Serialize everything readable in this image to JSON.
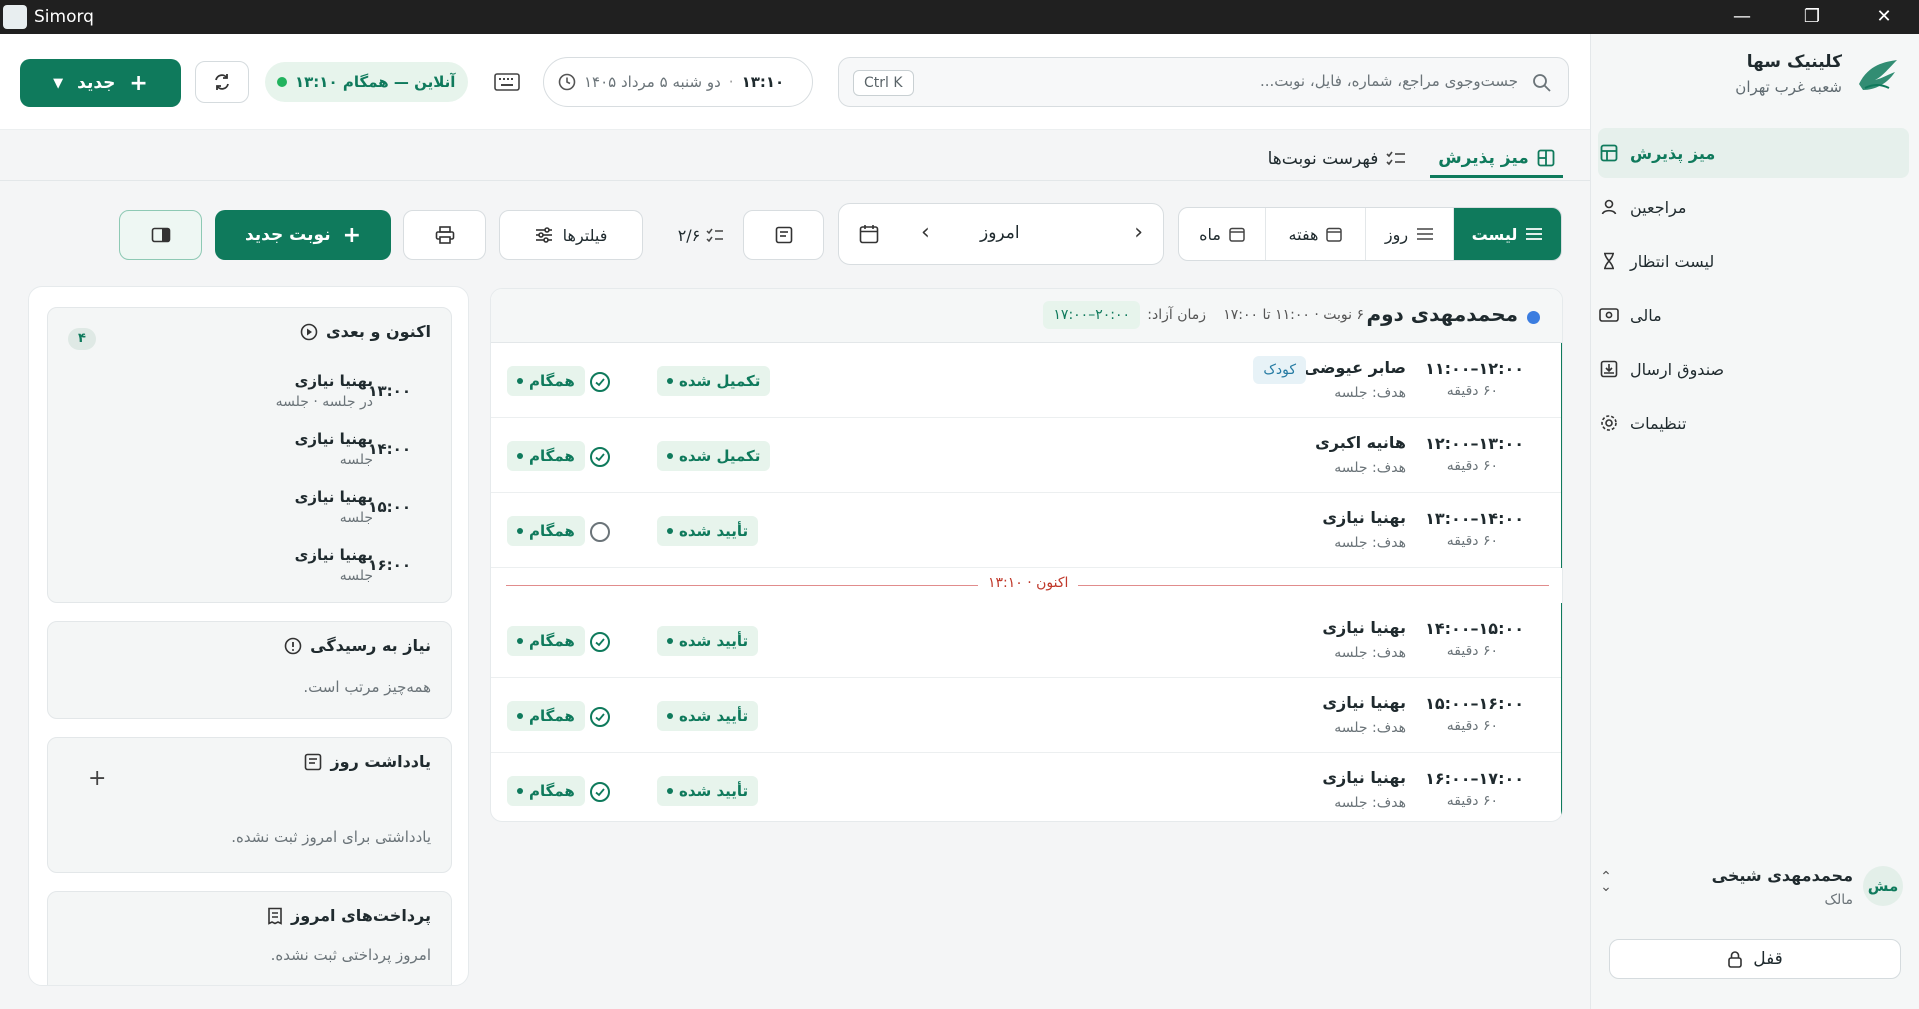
{
  "window": {
    "title": "Simorq"
  },
  "brand": {
    "name": "کلینیک سها",
    "branch": "شعبه غرب تهران"
  },
  "sidebar": {
    "items": [
      {
        "label": "میز پذیرش",
        "active": true,
        "icon": "layout-icon"
      },
      {
        "label": "مراجعین",
        "active": false,
        "icon": "user-icon"
      },
      {
        "label": "لیست انتظار",
        "active": false,
        "icon": "hourglass-icon"
      },
      {
        "label": "مالی",
        "active": false,
        "icon": "money-icon"
      },
      {
        "label": "صندوق ارسال",
        "active": false,
        "icon": "outbox-icon"
      },
      {
        "label": "تنظیمات",
        "active": false,
        "icon": "gear-icon"
      }
    ],
    "user": {
      "initials": "مش",
      "name": "محمدمهدی شیخی",
      "role": "مالک"
    },
    "lock_label": "قفل"
  },
  "header": {
    "search_placeholder": "جست‌وجوی مراجع، شماره، فایل، نوبت...",
    "shortcut": "Ctrl K",
    "date": "دو شنبه ۵ مرداد ۱۴۰۵",
    "time": "۱۳:۱۰",
    "status": "آنلاین — همگام ۱۳:۱۰",
    "new_label": "جدید"
  },
  "tabs": [
    {
      "label": "میز پذیرش",
      "active": true
    },
    {
      "label": "فهرست نوبت‌ها",
      "active": false
    }
  ],
  "toolbar": {
    "views": [
      "لیست",
      "روز",
      "هفته",
      "ماه"
    ],
    "active_view": "لیست",
    "date_label": "امروز",
    "count": "۲/۶",
    "filters_label": "فیلترها",
    "new_appointment_label": "نوبت جدید"
  },
  "schedule": {
    "practitioner": "محمدمهدی دوم",
    "summary": "۶ نوبت · ۱۱:۰۰ تا ۱۷:۰۰",
    "free_label": "زمان آزاد:",
    "free_slot": "۲۰:۰۰–۱۷:۰۰",
    "now_label": "اکنون · ۱۳:۱۰",
    "rows": [
      {
        "time": "۱۱:۰۰–۱۲:۰۰",
        "duration": "۶۰ دقیقه",
        "name": "صابر عیوضی",
        "tag": "کودک",
        "goal": "هدف: جلسه",
        "status": "تکمیل شده",
        "sync": "همگام",
        "checked": true,
        "door": true
      },
      {
        "time": "۱۲:۰۰–۱۳:۰۰",
        "duration": "۶۰ دقیقه",
        "name": "هانیه اکبری",
        "tag": "",
        "goal": "هدف: جلسه",
        "status": "تکمیل شده",
        "sync": "همگام",
        "checked": true,
        "door": true
      },
      {
        "time": "۱۳:۰۰–۱۴:۰۰",
        "duration": "۶۰ دقیقه",
        "name": "بهنیا نیازی",
        "tag": "",
        "goal": "هدف: جلسه",
        "status": "تأیید شده",
        "sync": "همگام",
        "checked": false,
        "door": false
      },
      {
        "time": "۱۴:۰۰–۱۵:۰۰",
        "duration": "۶۰ دقیقه",
        "name": "بهنیا نیازی",
        "tag": "",
        "goal": "هدف: جلسه",
        "status": "تأیید شده",
        "sync": "همگام",
        "checked": true,
        "door": false
      },
      {
        "time": "۱۵:۰۰–۱۶:۰۰",
        "duration": "۶۰ دقیقه",
        "name": "بهنیا نیازی",
        "tag": "",
        "goal": "هدف: جلسه",
        "status": "تأیید شده",
        "sync": "همگام",
        "checked": true,
        "door": false
      },
      {
        "time": "۱۶:۰۰–۱۷:۰۰",
        "duration": "۶۰ دقیقه",
        "name": "بهنیا نیازی",
        "tag": "",
        "goal": "هدف: جلسه",
        "status": "تأیید شده",
        "sync": "همگام",
        "checked": true,
        "door": false
      }
    ]
  },
  "panels": {
    "upcoming": {
      "title": "اکنون و بعدی",
      "count": "۴",
      "items": [
        {
          "time": "۱۳:۰۰",
          "name": "بهنیا نیازی",
          "sub": "در جلسه · جلسه"
        },
        {
          "time": "۱۴:۰۰",
          "name": "بهنیا نیازی",
          "sub": "جلسه"
        },
        {
          "time": "۱۵:۰۰",
          "name": "بهنیا نیازی",
          "sub": "جلسه"
        },
        {
          "time": "۱۶:۰۰",
          "name": "بهنیا نیازی",
          "sub": "جلسه"
        }
      ]
    },
    "attention": {
      "title": "نیاز به رسیدگی",
      "text": "همه‌چیز مرتب است."
    },
    "notes": {
      "title": "یادداشت روز",
      "text": "یادداشتی برای امروز ثبت نشده."
    },
    "payments": {
      "title": "پرداخت‌های امروز",
      "text": "امروز پرداختی ثبت نشده."
    }
  },
  "colors": {
    "accent": "#0f7a5c",
    "now_line": "#e18c8c",
    "online": "#22b35e"
  }
}
